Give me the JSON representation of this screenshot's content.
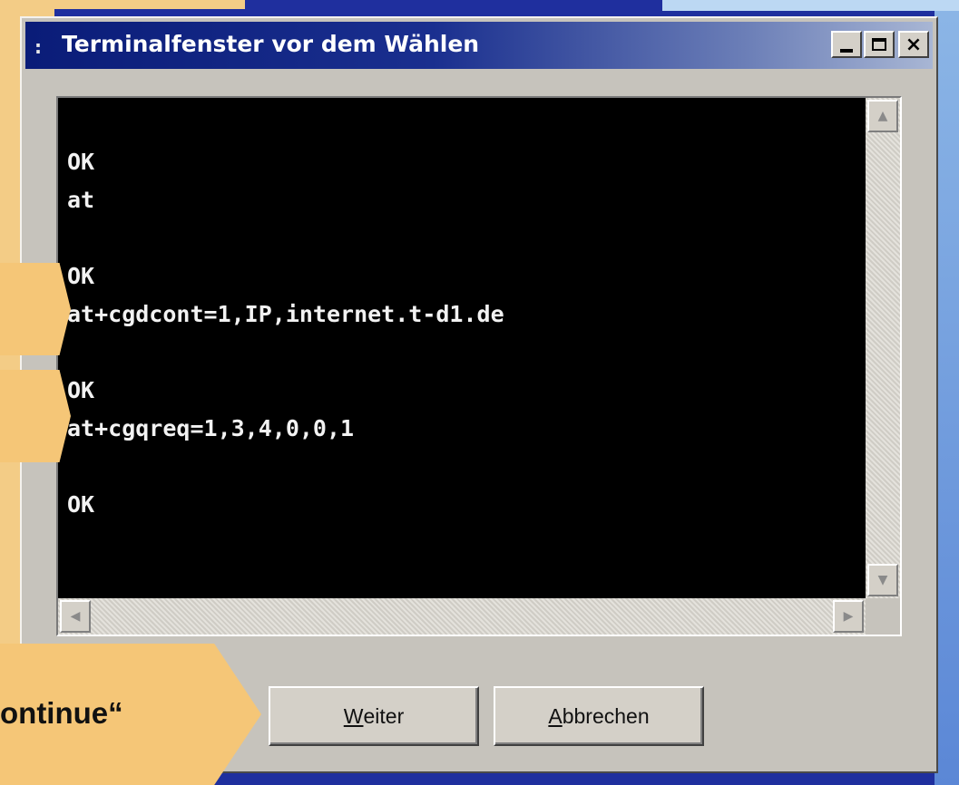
{
  "window": {
    "title": "Terminalfenster vor dem Wählen",
    "title_icon": ":"
  },
  "titlebar_buttons": {
    "minimize": "",
    "maximize": "",
    "close": "×"
  },
  "terminal": {
    "lines": [
      "OK",
      "at",
      "",
      "OK",
      "at+cgdcont=1,IP,internet.t-d1.de",
      "",
      "OK",
      "at+cgqreq=1,3,4,0,0,1",
      "",
      "OK"
    ]
  },
  "scrollbars": {
    "up": "▲",
    "down": "▼",
    "left": "◀",
    "right": "▶"
  },
  "buttons": {
    "continue_mnemonic": "W",
    "continue_rest": "eiter",
    "cancel_mnemonic": "A",
    "cancel_rest": "bbrechen"
  },
  "annotations": {
    "continue_callout": "ontinue“"
  },
  "colors": {
    "background": "#1f2f9e",
    "callout": "#f5c677",
    "terminal_bg": "#000000",
    "terminal_fg": "#f2f2f2",
    "titlebar_start": "#0a1c78",
    "window_face": "#c6c3bc"
  }
}
